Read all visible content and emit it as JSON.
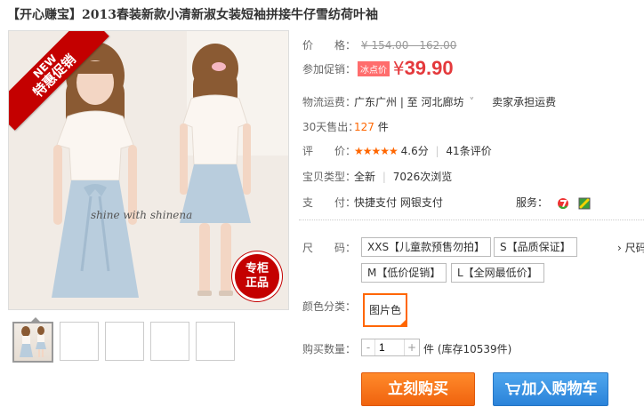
{
  "title": "【开心赚宝】2013春装新款小清新淑女装短袖拼接牛仔雪纺荷叶袖",
  "image": {
    "ribbon_new": "NEW",
    "ribbon_text": "特惠促销",
    "seal_text": "专柜正品",
    "photo_caption": "shine with shinena"
  },
  "price": {
    "label": "价　　格：",
    "original": "¥ 154.00 - 162.00"
  },
  "promo": {
    "label": "参加促销：",
    "tag": "冰点价",
    "yen": "¥",
    "value": "39.90"
  },
  "shipping": {
    "label": "物流运费：",
    "route": "广东广州 | 至  河北廊坊",
    "caret": "˅",
    "note": "卖家承担运费"
  },
  "sales": {
    "label": "30天售出：",
    "value": "127",
    "unit": "件"
  },
  "rating": {
    "label": "评　　价：",
    "stars": "★★★★★",
    "score": "4.6分",
    "sep": "|",
    "reviews": "41条评价"
  },
  "item_type": {
    "label": "宝贝类型：",
    "value": "全新",
    "sep": "|",
    "views": "7026次浏览"
  },
  "payment": {
    "label": "支　　付：",
    "methods": "快捷支付  网银支付",
    "service_label": "服务："
  },
  "size": {
    "label": "尺　　码：",
    "options": [
      "XXS【儿童款预售勿拍】",
      "S【品质保证】",
      "M【低价促销】",
      "L【全网最低价】"
    ],
    "more": "› 尺码"
  },
  "color": {
    "label": "颜色分类：",
    "selected": "图片色"
  },
  "quantity": {
    "label": "购买数量：",
    "minus": "-",
    "value": "1",
    "plus": "+",
    "stock": "件 (库存10539件)"
  },
  "buttons": {
    "buy_now": "立刻购买",
    "add_cart": "加入购物车"
  },
  "colors": {
    "price_red": "#e4393c",
    "buy_orange": "#f0630e",
    "cart_blue": "#2b83d9",
    "accent_orange": "#ff6600"
  }
}
